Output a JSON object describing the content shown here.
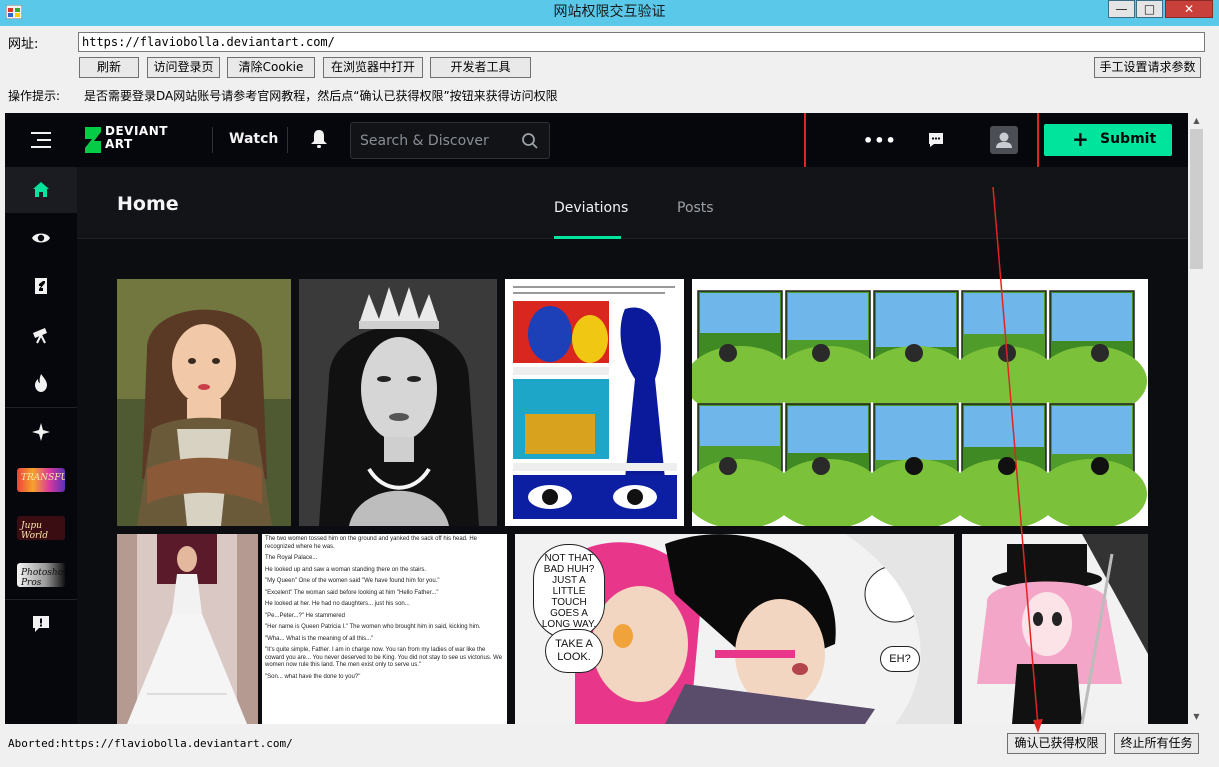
{
  "window": {
    "title": "网站权限交互验证",
    "min_glyph": "—",
    "max_glyph": "□",
    "close_glyph": "✕"
  },
  "form": {
    "address_label": "网址:",
    "address_value": "https://flaviobolla.deviantart.com/",
    "buttons": {
      "refresh": "刷新",
      "visit_login": "访问登录页",
      "clear_cookie": "清除Cookie",
      "open_browser": "在浏览器中打开",
      "devtools": "开发者工具",
      "manual_params": "手工设置请求参数"
    },
    "hint_label": "操作提示:",
    "hint_text": "是否需要登录DA网站账号请参考官网教程，然后点“确认已获得权限”按钮来获得访问权限"
  },
  "site": {
    "logo_line1": "DEVIANT",
    "logo_line2": "ART",
    "watch_label": "Watch",
    "search_placeholder": "Search & Discover",
    "more_glyph": "•••",
    "submit_label": "Submit",
    "submit_plus": "+",
    "home_title": "Home",
    "tabs": [
      "Deviations",
      "Posts"
    ],
    "sidebar_thumbs": [
      "TRANSFUSE",
      "Jupu World",
      "Photoshop Pros"
    ],
    "comic_bubbles": [
      "NOT THAT BAD HUH? JUST A LITTLE TOUCH GOES A LONG WAY.",
      "TAKE A LOOK.",
      "EH?"
    ],
    "story_lines": [
      "The two women tossed him on the ground and yanked the sack off his head. He recognized where he was.",
      "The Royal Palace...",
      "He looked up and saw a woman standing there on the stairs.",
      "\"My Queen\" One of the women said \"We have found him for you.\"",
      "\"Excelent\" The woman said before looking at him \"Hello Father...\"",
      "He looked at her. He had no daughters... just his son...",
      "\"Pe...Peter...?\" He stammered",
      "\"Her name is Queen Patricia I.\" The women who brought him in said, kicking him.",
      "\"Wha... What is the meaning of all this...\"",
      "\"It's quite simple, Father. I am in charge now. You ran from my ladies of war like the coward you are... You never deserved to be King. You did not stay to see us victorius. We women now rule this land. The men exist only to serve us.\"",
      "\"Son... what have the done to you?\""
    ]
  },
  "status": {
    "text": "Aborted:https://flaviobolla.deviantart.com/",
    "confirm_button": "确认已获得权限",
    "stop_button": "终止所有任务"
  },
  "colors": {
    "titlebar": "#5ac8e8",
    "da_green": "#00e59b",
    "highlight_red": "#e02424",
    "da_bg": "#06070d"
  }
}
